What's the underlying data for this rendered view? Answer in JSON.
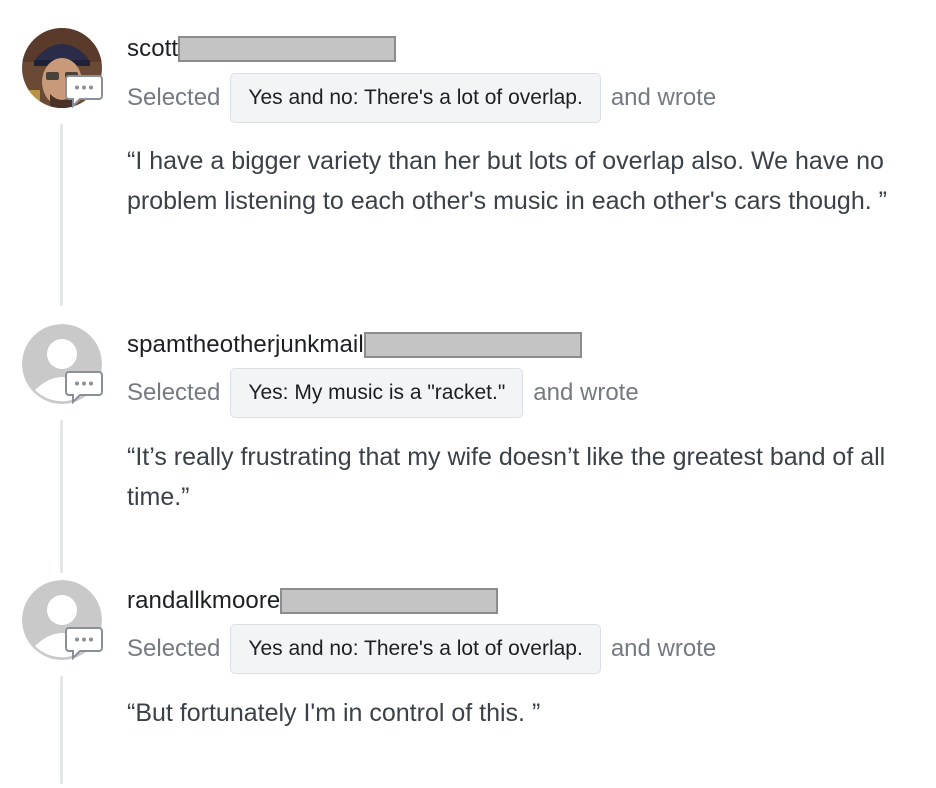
{
  "entries": [
    {
      "username": "scott",
      "avatar": "photo",
      "selected_label": "Selected",
      "choice": "Yes and no: There's a lot of overlap.",
      "wrote_label": "and wrote",
      "quote": "“I have a bigger variety than her but lots of overlap also. We have no problem listening to each other's music in each other's cars though. ”"
    },
    {
      "username": "spamtheotherjunkmail",
      "avatar": "default",
      "selected_label": "Selected",
      "choice": "Yes: My music is a \"racket.\"",
      "wrote_label": "and wrote",
      "quote": "“It’s really frustrating that my wife doesn’t like the greatest band of all time.”"
    },
    {
      "username": "randallkmoore",
      "avatar": "default",
      "selected_label": "Selected",
      "choice": "Yes and no: There's a lot of overlap.",
      "wrote_label": "and wrote",
      "quote": "“But fortunately I'm in control of this. ”"
    }
  ],
  "icons": {
    "comment_badge": "speech-bubble-icon",
    "default_avatar": "default-user-icon"
  },
  "colors": {
    "pill_bg": "#f3f4f6",
    "pill_border": "#dcdfe3",
    "muted_text": "#747a82",
    "body_text": "#3b4148",
    "redaction": "#c4c4c4"
  }
}
